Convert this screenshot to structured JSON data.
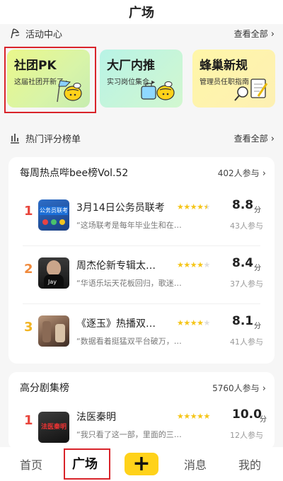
{
  "header": {
    "title": "广场"
  },
  "activity": {
    "title": "活动中心",
    "more": "查看全部",
    "cards": [
      {
        "title": "社团PK",
        "subtitle": "这届社团开新了"
      },
      {
        "title": "大厂内推",
        "subtitle": "实习岗位集合"
      },
      {
        "title": "蜂巢新规",
        "subtitle": "管理员任职指南"
      }
    ]
  },
  "ranking": {
    "title": "热门评分榜单",
    "more": "查看全部",
    "lists": [
      {
        "title": "每周热点哔bee榜Vol.52",
        "count": "402人参与",
        "items": [
          {
            "rank": "1",
            "title": "3月14日公务员联考",
            "quote": "“这场联考是每年毕业生和在…",
            "rating": 4.5,
            "score": "8.8",
            "unit": "分",
            "people": "43人参与",
            "rank_color": "#e8453c",
            "thumb_label": "公务员联考"
          },
          {
            "rank": "2",
            "title": "周杰伦新专辑太…",
            "quote": "“华语乐坛天花板回归，歌迷…",
            "rating": 4,
            "score": "8.4",
            "unit": "分",
            "people": "37人参与",
            "rank_color": "#f08a3c",
            "thumb_label": "Jay"
          },
          {
            "rank": "3",
            "title": "《逐玉》热播双…",
            "quote": "“数据看着挺猛双平台破万，…",
            "rating": 4,
            "score": "8.1",
            "unit": "分",
            "people": "41人参与",
            "rank_color": "#f2b422",
            "thumb_label": ""
          }
        ]
      },
      {
        "title": "高分剧集榜",
        "count": "5760人参与",
        "items": [
          {
            "rank": "1",
            "title": "法医秦明",
            "quote": "“我只看了这一部，里面的三…",
            "rating": 5,
            "score": "10.0",
            "unit": "分",
            "people": "12人参与",
            "rank_color": "#e8453c",
            "thumb_label": "法医秦明"
          }
        ]
      }
    ]
  },
  "tabbar": {
    "home": "首页",
    "square": "广场",
    "add": "+",
    "messages": "消息",
    "mine": "我的"
  },
  "colors": {
    "accent": "#ffd21a",
    "star": "#f5c518",
    "star_empty": "#dddddd",
    "highlight_box": "#d9232a"
  }
}
